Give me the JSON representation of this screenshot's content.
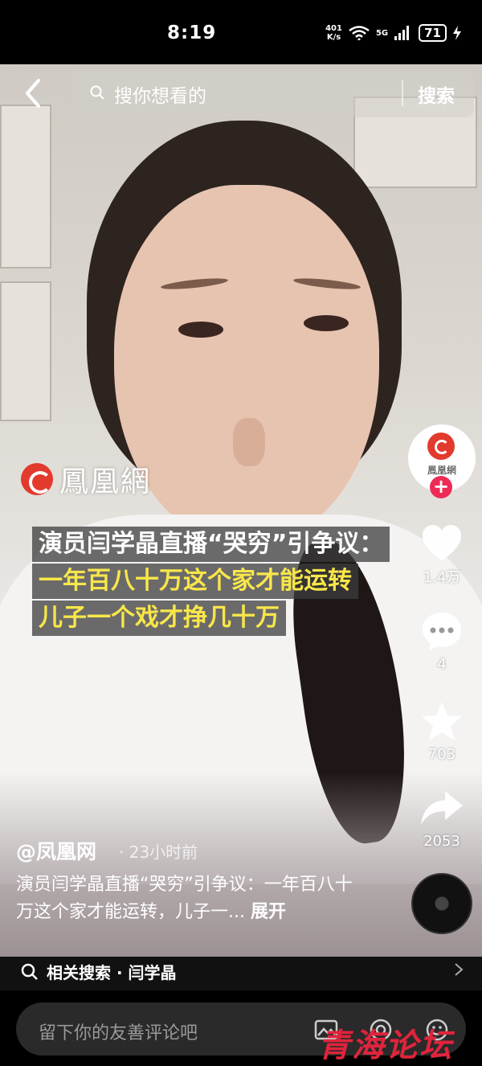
{
  "status_bar": {
    "time": "8:19",
    "net_speed_top": "401",
    "net_speed_bottom": "K/s",
    "signal": "5G",
    "battery": "71"
  },
  "search": {
    "placeholder": "搜你想看的",
    "button": "搜索"
  },
  "video": {
    "watermark": "鳳凰網",
    "caption": {
      "line1": "演员闫学晶直播“哭穷”引争议：",
      "line2": "一年百八十万这个家才能运转",
      "line3": "儿子一个戏才挣几十万"
    }
  },
  "rail": {
    "avatar_text": "鳳凰網",
    "follow": "+",
    "likes": "1.4万",
    "comments": "4",
    "favorites": "703",
    "shares": "2053"
  },
  "post": {
    "author": "@凤凰网",
    "time": "· 23小时前",
    "description": "演员闫学晶直播“哭穷”引争议：一年百八十万这个家才能运转，儿子一...",
    "more": "展开"
  },
  "related": {
    "label": "相关搜索 · 闫学晶"
  },
  "comment": {
    "placeholder": "留下你的友善评论吧"
  },
  "brand_watermark": "青海论坛",
  "colors": {
    "follow_red": "#ee2a55",
    "caption_yellow": "#f8e64a",
    "phoenix_red": "#e23a2c",
    "brand_red": "#e0243c"
  },
  "icons": [
    "back-icon",
    "search-icon",
    "heart-icon",
    "comment-icon",
    "star-icon",
    "share-icon",
    "music-disc-icon",
    "image-icon",
    "emoji-icon",
    "chevron-right-icon"
  ]
}
